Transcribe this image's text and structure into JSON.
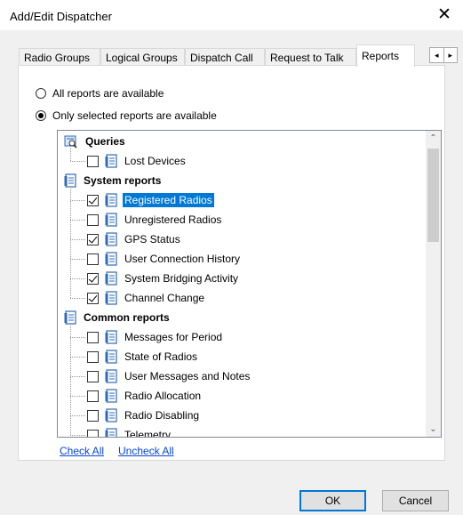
{
  "window": {
    "title": "Add/Edit Dispatcher",
    "close_glyph": "✕"
  },
  "tabs": [
    {
      "label": "Radio Groups"
    },
    {
      "label": "Logical Groups"
    },
    {
      "label": "Dispatch Call"
    },
    {
      "label": "Request to Talk"
    },
    {
      "label": "Reports",
      "active": true
    }
  ],
  "tab_scroll": {
    "left": "◂",
    "right": "▸"
  },
  "radios": {
    "all": {
      "label": "All reports are available",
      "selected": false
    },
    "selected_only": {
      "label": "Only selected reports are available",
      "selected": true
    }
  },
  "tree": {
    "groups": [
      {
        "label": "Queries",
        "icon": "queries-icon",
        "items": [
          {
            "label": "Lost Devices",
            "checked": false
          }
        ]
      },
      {
        "label": "System reports",
        "icon": "report-icon",
        "items": [
          {
            "label": "Registered Radios",
            "checked": true,
            "selected": true
          },
          {
            "label": "Unregistered Radios",
            "checked": false
          },
          {
            "label": "GPS Status",
            "checked": true
          },
          {
            "label": "User Connection History",
            "checked": false
          },
          {
            "label": "System Bridging Activity",
            "checked": true
          },
          {
            "label": "Channel Change",
            "checked": true
          }
        ]
      },
      {
        "label": "Common reports",
        "icon": "report-icon",
        "items": [
          {
            "label": "Messages for Period",
            "checked": false
          },
          {
            "label": "State of Radios",
            "checked": false
          },
          {
            "label": "User Messages and Notes",
            "checked": false
          },
          {
            "label": "Radio Allocation",
            "checked": false
          },
          {
            "label": "Radio Disabling",
            "checked": false
          },
          {
            "label": "Telemetry",
            "checked": false
          }
        ]
      }
    ],
    "scroll_up": "⌃",
    "scroll_down": "⌄"
  },
  "links": {
    "check_all": "Check All",
    "uncheck_all": "Uncheck All"
  },
  "buttons": {
    "ok": "OK",
    "cancel": "Cancel"
  },
  "colors": {
    "selection": "#0078d7",
    "link": "#0645d8"
  }
}
